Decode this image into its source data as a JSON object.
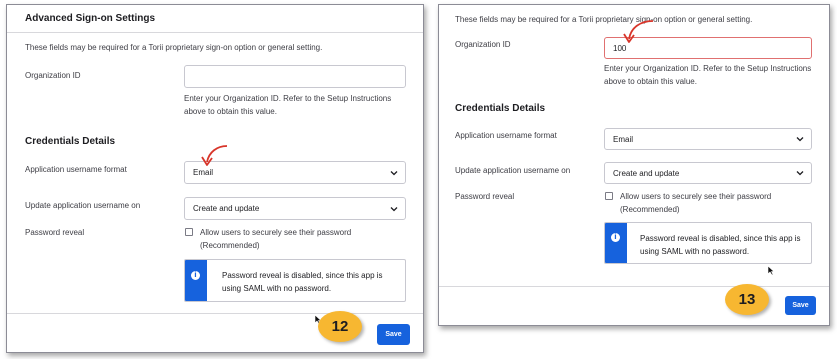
{
  "left_panel": {
    "section_title": "Advanced Sign-on Settings",
    "intro": "These fields may be required for a Torii proprietary sign-on option or general setting.",
    "org_id": {
      "label": "Organization ID",
      "value": "",
      "help_line1": "Enter your Organization ID. Refer to the Setup Instructions",
      "help_line2": "above to obtain this value."
    },
    "credentials_title": "Credentials Details",
    "username_format": {
      "label": "Application username format",
      "value": "Email"
    },
    "update_on": {
      "label": "Update application username on",
      "value": "Create and update"
    },
    "password_reveal": {
      "label": "Password reveal",
      "checkbox_line1": "Allow users to securely see their password",
      "checkbox_line2": "(Recommended)",
      "checked": false
    },
    "callout": {
      "icon": "info-icon",
      "line1": "Password reveal is disabled, since this app is",
      "line2": "using SAML with no password."
    },
    "save_label": "Save",
    "step_number": "12"
  },
  "right_panel": {
    "intro": "These fields may be required for a Torii proprietary sign-on option or general setting.",
    "org_id": {
      "label": "Organization ID",
      "value": "100",
      "help_line1": "Enter your Organization ID. Refer to the Setup Instructions",
      "help_line2": "above to obtain this value."
    },
    "credentials_title": "Credentials Details",
    "username_format": {
      "label": "Application username format",
      "value": "Email"
    },
    "update_on": {
      "label": "Update application username on",
      "value": "Create and update"
    },
    "password_reveal": {
      "label": "Password reveal",
      "checkbox_line1": "Allow users to securely see their password",
      "checkbox_line2": "(Recommended)",
      "checked": false
    },
    "callout": {
      "icon": "info-icon",
      "line1": "Password reveal is disabled, since this app is",
      "line2": "using SAML with no password."
    },
    "save_label": "Save",
    "step_number": "13"
  },
  "colors": {
    "accent": "#1662dd",
    "annotation_arrow": "#d8352a",
    "step_badge": "#f7b731",
    "error_border": "#e07070"
  }
}
